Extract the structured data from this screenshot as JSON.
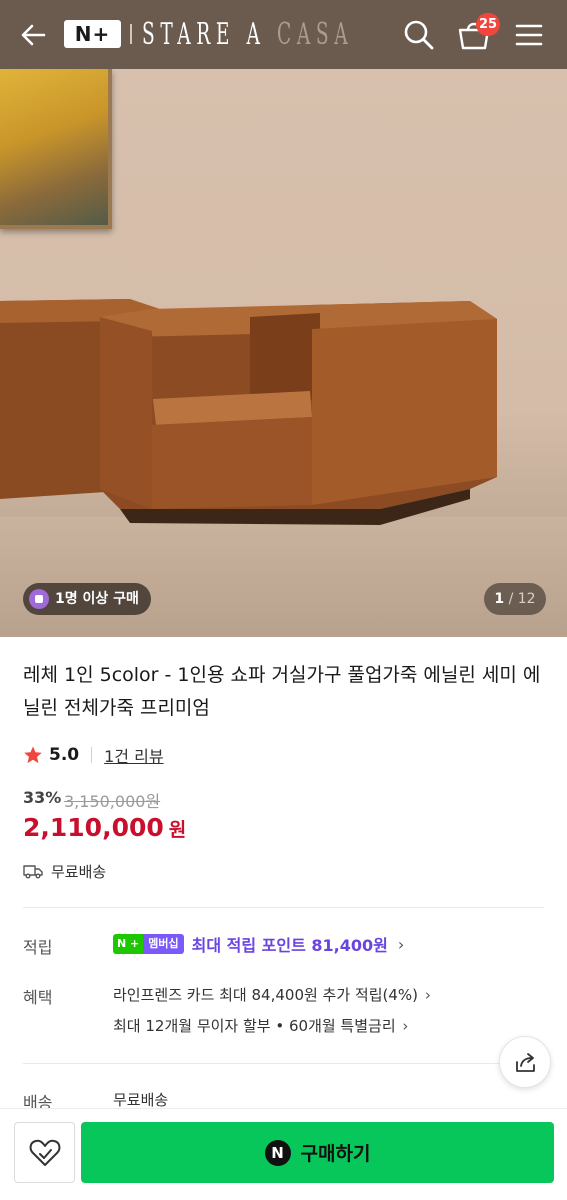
{
  "header": {
    "logo_text": "N+",
    "brand_main": "STARE A ",
    "brand_dim": "CASA",
    "cart_count": "25"
  },
  "gallery": {
    "buy_badge": "1명 이상 구매",
    "page_current": "1",
    "page_total": "/ 12"
  },
  "product": {
    "title": "레체 1인 5color - 1인용 쇼파 거실가구 풀업가죽 에닐린 세미 에닐린 전체가죽 프리미엄",
    "rating": "5.0",
    "review_link": "1건 리뷰",
    "discount": "33%",
    "original_price": "3,150,000원",
    "price": "2,110,000",
    "price_unit": "원",
    "shipping": "무료배송"
  },
  "details": {
    "points_label": "적립",
    "points_badge_n": "N +",
    "points_badge_member": "멤버십",
    "points_text": "최대 적립 포인트 81,400원",
    "benefit_label": "혜택",
    "benefit_line1": "라인프렌즈 카드 최대 84,400원 추가 적립(4%)",
    "benefit_line2": "최대 12개월 무이자 할부 • 60개월 특별금리",
    "delivery_label": "배송",
    "delivery_value": "무료배송"
  },
  "bottom_bar": {
    "buy_icon": "N",
    "buy_label": "구매하기"
  },
  "colors": {
    "header_bg": "#6b5a4e",
    "price_red": "#c8102e",
    "buy_green": "#08c75a",
    "point_purple": "#6a44e0"
  }
}
